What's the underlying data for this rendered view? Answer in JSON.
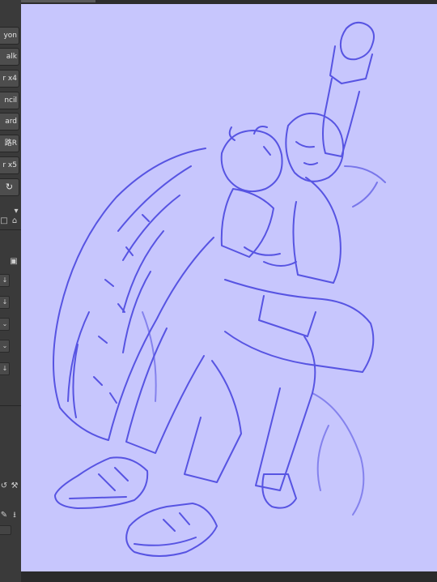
{
  "brush_palette": {
    "items": [
      {
        "label": "yon"
      },
      {
        "label": "alk"
      },
      {
        "label": "r x4"
      },
      {
        "label": "ncil"
      },
      {
        "label": "ard"
      },
      {
        "label": "路R"
      },
      {
        "label": "r x5"
      }
    ]
  },
  "icons": {
    "lasso": "lasso-icon",
    "chevron": "chevron-down-icon",
    "copy": "copy-icon",
    "trash": "trash-icon",
    "lock": "lock-icon",
    "layer_down": "layer-download-icon",
    "refresh": "refresh-icon",
    "wrench": "wrench-icon",
    "paint": "paint-icon",
    "download": "download-icon"
  },
  "canvas": {
    "background": "#c7c6fd",
    "stroke_color": "#4b48e0"
  }
}
